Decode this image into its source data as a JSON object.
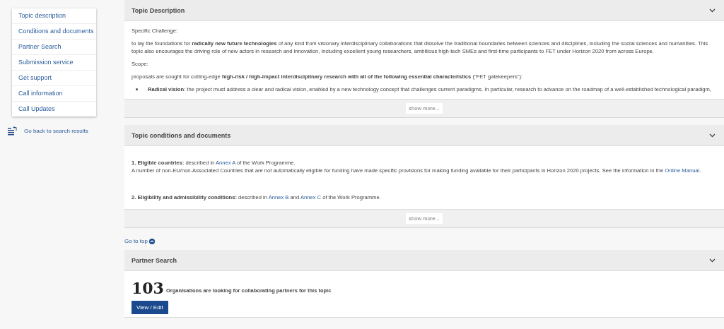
{
  "sidebar": {
    "items": [
      {
        "label": "Topic description"
      },
      {
        "label": "Conditions and documents"
      },
      {
        "label": "Partner Search"
      },
      {
        "label": "Submission service"
      },
      {
        "label": "Get support"
      },
      {
        "label": "Call information"
      },
      {
        "label": "Call Updates"
      }
    ],
    "back_link": "Go back to search results"
  },
  "sections": [
    {
      "title": "Topic Description",
      "show_more": "show more...",
      "blocks": [
        {
          "kind": "para",
          "segments": [
            {
              "kind": "text",
              "text": "Specific Challenge:"
            }
          ]
        },
        {
          "kind": "para",
          "segments": [
            {
              "kind": "text",
              "text": "to lay the foundations for "
            },
            {
              "kind": "bold",
              "text": "radically new future technologies"
            },
            {
              "kind": "text",
              "text": " of any kind from visionary interdisciplinary collaborations that dissolve the traditional boundaries between sciences and disciplines, including the social sciences and humanities. This topic also encourages the driving role of new actors in research and innovation, including excellent young researchers, ambitious high-tech SMEs and first-time participants to FET under Horizon 2020 from across Europe."
            }
          ]
        },
        {
          "kind": "para",
          "segments": [
            {
              "kind": "text",
              "text": "Scope:"
            }
          ]
        },
        {
          "kind": "para",
          "segments": [
            {
              "kind": "text",
              "text": "proposals are sought for cutting-edge "
            },
            {
              "kind": "bold",
              "text": "high-risk / high-impact interdisciplinary research with all of the following essential characteristics"
            },
            {
              "kind": "text",
              "text": " (\"FET gatekeepers\"):"
            }
          ]
        },
        {
          "kind": "bullet",
          "segments": [
            {
              "kind": "bold",
              "text": "Radical vision"
            },
            {
              "kind": "text",
              "text": ": the project must address a clear and radical vision, enabled by a new technology concept that challenges current paradigms. In particular, research to advance on the roadmap of a well-established technological paradigm,"
            }
          ]
        }
      ]
    },
    {
      "title": "Topic conditions and documents",
      "show_more": "show more...",
      "blocks": [
        {
          "kind": "para",
          "segments": [
            {
              "kind": "bold",
              "text": "1. Eligible countries:"
            },
            {
              "kind": "text",
              "text": " described in "
            },
            {
              "kind": "link",
              "text": "Annex A"
            },
            {
              "kind": "text",
              "text": " of the Work Programme."
            },
            {
              "kind": "break"
            },
            {
              "kind": "text",
              "text": "A number of non-EU/non-Associated Countries that are not automatically eligible for funding have made specific provisions for making funding available for their participants in Horizon 2020 projects. See the information in the "
            },
            {
              "kind": "link",
              "text": "Online Manual"
            },
            {
              "kind": "text",
              "text": "."
            }
          ]
        },
        {
          "kind": "spacer"
        },
        {
          "kind": "para",
          "segments": [
            {
              "kind": "bold",
              "text": "2. Eligibility and admissibility conditions:"
            },
            {
              "kind": "text",
              "text": " described in "
            },
            {
              "kind": "link",
              "text": "Annex B"
            },
            {
              "kind": "text",
              "text": " and "
            },
            {
              "kind": "link",
              "text": "Annex C"
            },
            {
              "kind": "text",
              "text": " of the Work Programme."
            }
          ]
        }
      ]
    }
  ],
  "go_to_top": "Go to top",
  "partner_search": {
    "title": "Partner Search",
    "count": "103",
    "text": "Organisations are looking for collaborating partners for this topic",
    "button": "View / Edit"
  }
}
